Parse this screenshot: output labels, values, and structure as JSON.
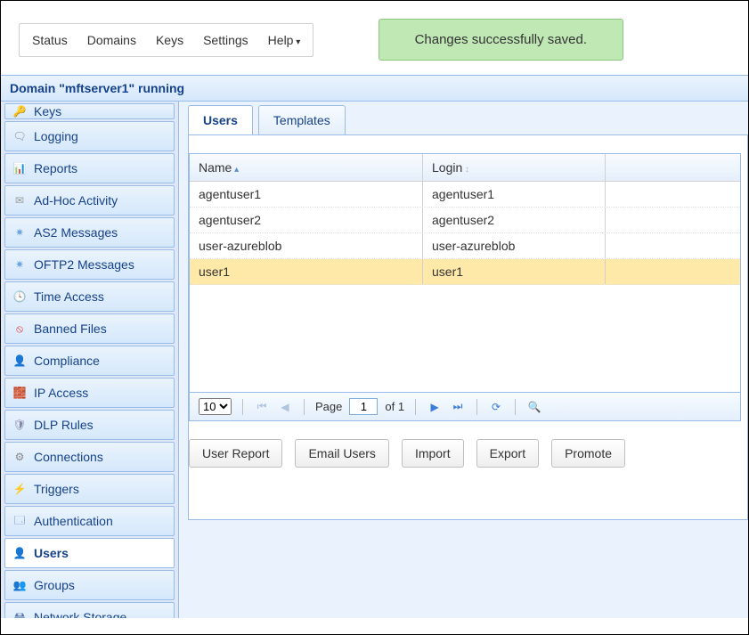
{
  "topnav": {
    "items": [
      "Status",
      "Domains",
      "Keys",
      "Settings",
      "Help"
    ]
  },
  "alert": {
    "message": "Changes successfully saved."
  },
  "status_line": "Domain \"mftserver1\" running",
  "sidebar": {
    "partial_top": {
      "label": "Keys",
      "icon": "key-icon"
    },
    "items": [
      {
        "label": "Logging",
        "icon": "logging-icon"
      },
      {
        "label": "Reports",
        "icon": "reports-icon"
      },
      {
        "label": "Ad-Hoc Activity",
        "icon": "mail-icon"
      },
      {
        "label": "AS2 Messages",
        "icon": "as2-icon"
      },
      {
        "label": "OFTP2 Messages",
        "icon": "oftp2-icon"
      },
      {
        "label": "Time Access",
        "icon": "time-icon"
      },
      {
        "label": "Banned Files",
        "icon": "banned-icon"
      },
      {
        "label": "Compliance",
        "icon": "compliance-icon"
      },
      {
        "label": "IP Access",
        "icon": "ip-icon"
      },
      {
        "label": "DLP Rules",
        "icon": "dlp-icon"
      },
      {
        "label": "Connections",
        "icon": "connections-icon"
      },
      {
        "label": "Triggers",
        "icon": "triggers-icon"
      },
      {
        "label": "Authentication",
        "icon": "auth-icon"
      },
      {
        "label": "Users",
        "icon": "users-icon",
        "active": true
      },
      {
        "label": "Groups",
        "icon": "groups-icon"
      },
      {
        "label": "Network Storage",
        "icon": "storage-icon"
      }
    ]
  },
  "tabs": {
    "items": [
      {
        "label": "Users",
        "active": true
      },
      {
        "label": "Templates",
        "active": false
      }
    ]
  },
  "grid": {
    "columns": [
      {
        "label": "Name",
        "sort": "asc"
      },
      {
        "label": "Login",
        "sort": "none"
      }
    ],
    "rows": [
      {
        "name": "agentuser1",
        "login": "agentuser1",
        "selected": false
      },
      {
        "name": "agentuser2",
        "login": "agentuser2",
        "selected": false
      },
      {
        "name": "user-azureblob",
        "login": "user-azureblob",
        "selected": false
      },
      {
        "name": "user1",
        "login": "user1",
        "selected": true
      }
    ]
  },
  "pager": {
    "page_size": "10",
    "page_label": "Page",
    "page_current": "1",
    "of_label": "of 1"
  },
  "actions": {
    "user_report": "User Report",
    "email_users": "Email Users",
    "import": "Import",
    "export": "Export",
    "promote": "Promote"
  }
}
